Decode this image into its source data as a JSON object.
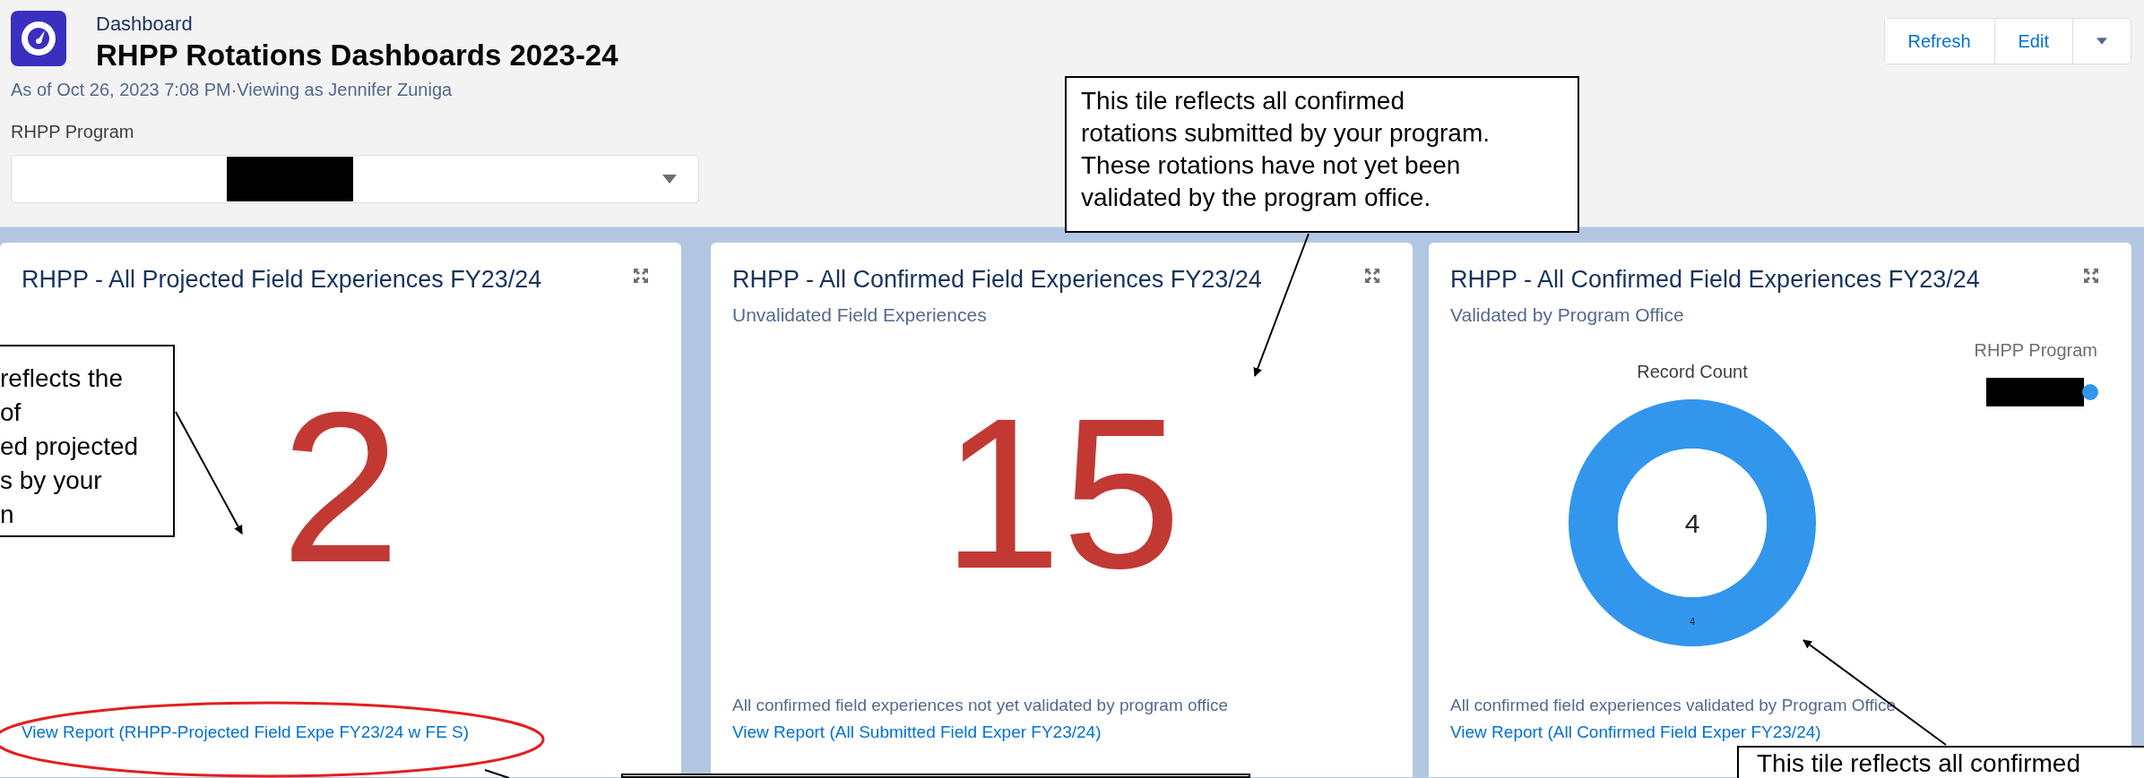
{
  "header": {
    "object_type": "Dashboard",
    "title": "RHPP Rotations Dashboards 2023-24",
    "subtitle": "As of Oct 26, 2023 7:08 PM·Viewing as Jennifer Zuniga",
    "buttons": [
      {
        "label": "Refresh"
      },
      {
        "label": "Edit"
      }
    ]
  },
  "filter": {
    "label": "RHPP Program"
  },
  "cards": [
    {
      "kind": "metric",
      "title": "RHPP - All Projected Field Experiences FY23/24",
      "value": "2",
      "link": "View Report (RHPP-Projected Field Expe FY23/24 w FE S)"
    },
    {
      "kind": "metric",
      "title": "RHPP - All Confirmed Field Experiences FY23/24",
      "subtitle": "Unvalidated Field Experiences",
      "value": "15",
      "footer": "All confirmed field experiences not yet validated by program office",
      "link": "View Report (All Submitted Field Exper FY23/24)"
    },
    {
      "kind": "donut",
      "title": "RHPP - All Confirmed Field Experiences FY23/24",
      "subtitle": "Validated by Program Office",
      "legend_title": "RHPP Program",
      "center_label": "4",
      "chart_data": {
        "type": "donut",
        "title": "Record Count",
        "series": [
          {
            "color": "#3296ed",
            "values": [
              4
            ]
          }
        ],
        "data_labels": true
      },
      "footer": "All confirmed field experiences validated by Program Office",
      "link": "View Report (All Confirmed Field Exper FY23/24)"
    }
  ],
  "annotations": [
    {
      "kind": "top",
      "lines": [
        "This tile reflects all confirmed",
        "rotations submitted by your program.",
        "These rotations have not yet been",
        "validated by the program office."
      ]
    },
    {
      "kind": "left",
      "lines": [
        "reflects the",
        "of",
        "ed projected",
        "s by your",
        "n"
      ]
    },
    {
      "kind": "bottom-right",
      "lines": [
        "This tile reflects all confirmed"
      ]
    }
  ]
}
